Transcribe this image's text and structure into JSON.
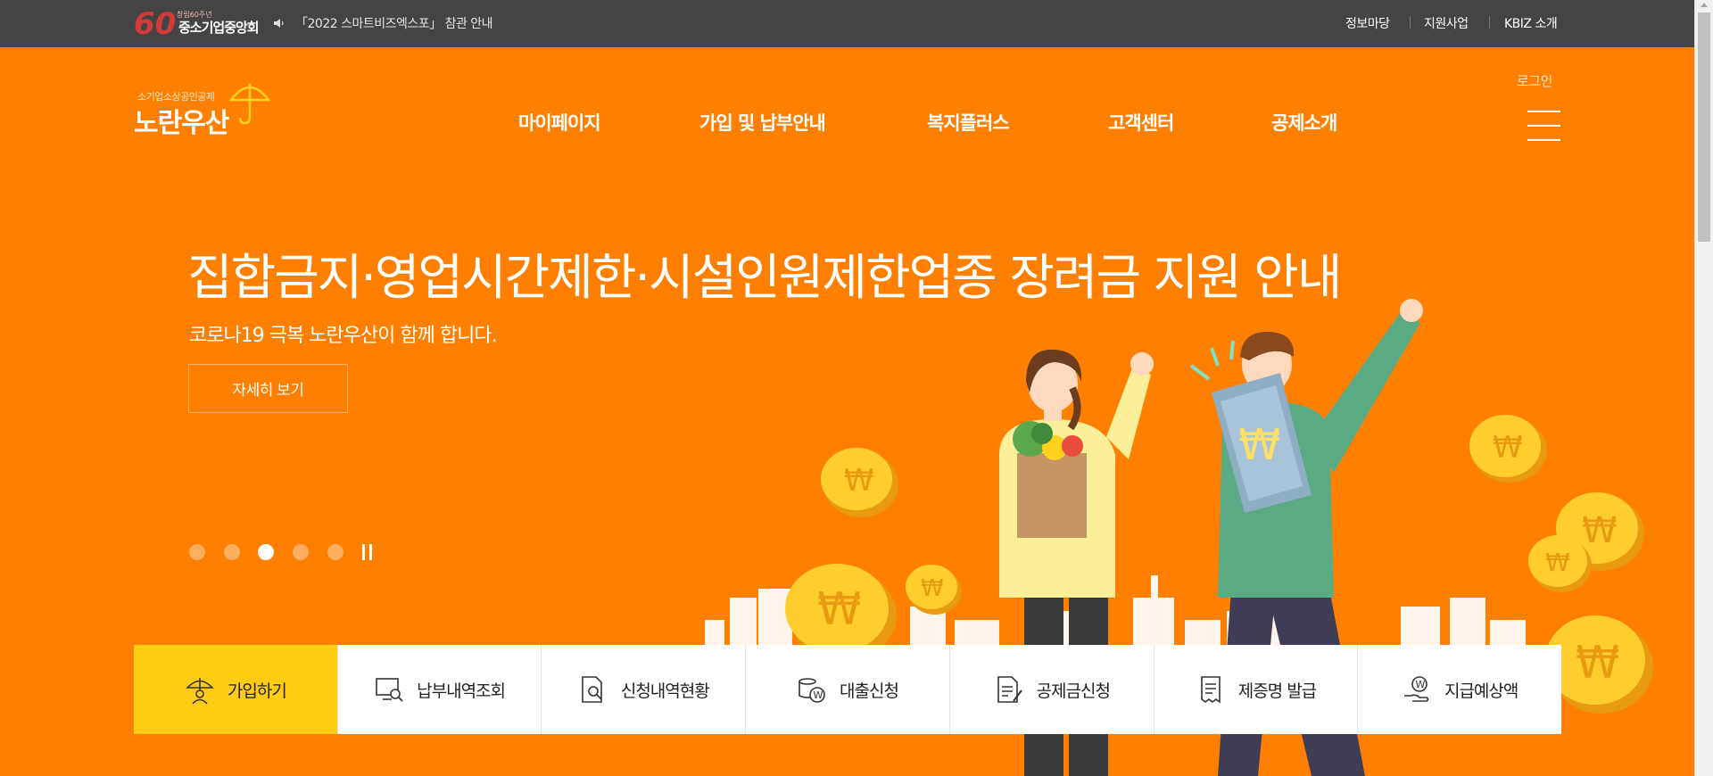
{
  "topbar": {
    "logo_number": "60",
    "logo_tagline": "창립60주년",
    "org_name": "중소기업중앙회",
    "notice": "「2022 스마트비즈엑스포」 참관 안내",
    "links": [
      "정보마당",
      "지원사업",
      "KBIZ 소개"
    ]
  },
  "header": {
    "brand_small": "소기업소상공인공제",
    "brand_name": "노란우산",
    "login": "로그인",
    "nav": [
      "마이페이지",
      "가입 및 납부안내",
      "복지플러스",
      "고객센터",
      "공제소개"
    ]
  },
  "hero": {
    "title": "집합금지·영업시간제한·시설인원제한업종 장려금 지원 안내",
    "subtitle": "코로나19 극복 노란우산이 함께 합니다.",
    "button": "자세히 보기",
    "slide_count": 5,
    "active_slide": 3
  },
  "quick_menu": [
    {
      "label": "가입하기",
      "icon": "umbrella-person-icon"
    },
    {
      "label": "납부내역조회",
      "icon": "monitor-search-icon"
    },
    {
      "label": "신청내역현황",
      "icon": "document-search-icon"
    },
    {
      "label": "대출신청",
      "icon": "coins-won-icon"
    },
    {
      "label": "공제금신청",
      "icon": "document-pen-icon"
    },
    {
      "label": "제증명 발급",
      "icon": "receipt-icon"
    },
    {
      "label": "지급예상액",
      "icon": "hand-won-icon"
    }
  ],
  "colors": {
    "brand_orange": "#ff8000",
    "topbar_bg": "#444444",
    "accent_yellow": "#ffcc14"
  }
}
